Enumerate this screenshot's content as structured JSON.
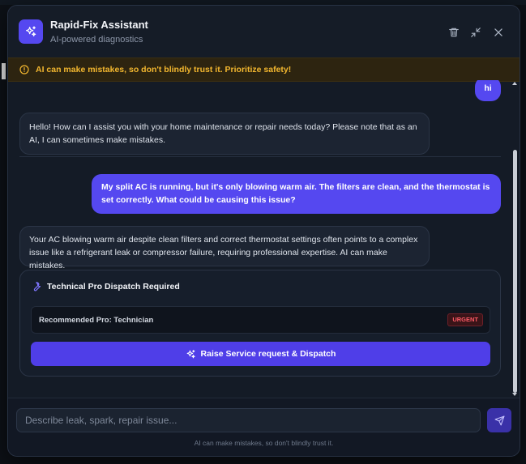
{
  "header": {
    "title": "Rapid-Fix Assistant",
    "subtitle": "AI-powered diagnostics",
    "icons": [
      "sparkles-icon",
      "trash-icon",
      "minimize-icon",
      "close-icon"
    ]
  },
  "banner": {
    "text": "AI can make mistakes, so don't blindly trust it. Prioritize safety!",
    "color": "#f3b72f"
  },
  "messages": [
    {
      "role": "user",
      "text": "hi"
    },
    {
      "role": "assistant",
      "text": "Hello! How can I assist you with your home maintenance or repair needs today? Please note that as an AI, I can sometimes make mistakes."
    },
    {
      "role": "user",
      "text": "My split AC is running, but it's only blowing warm air. The filters are clean, and the thermostat is set correctly. What could be causing this issue?"
    },
    {
      "role": "assistant",
      "text": "Your AC blowing warm air despite clean filters and correct thermostat settings often points to a complex issue like a refrigerant leak or compressor failure, requiring professional expertise. AI can make mistakes."
    }
  ],
  "dispatch": {
    "title": "Technical Pro Dispatch Required",
    "recommended": "Recommended Pro: Technician",
    "badge": "URGENT",
    "button_label": "Raise Service request & Dispatch"
  },
  "composer": {
    "placeholder": "Describe leak, spark, repair issue...",
    "value": "",
    "disclaimer": "AI can make mistakes, so don't blindly trust it."
  },
  "colors": {
    "accent": "#5548f0",
    "urgent": "#ff5a66",
    "warning": "#f3b72f"
  }
}
